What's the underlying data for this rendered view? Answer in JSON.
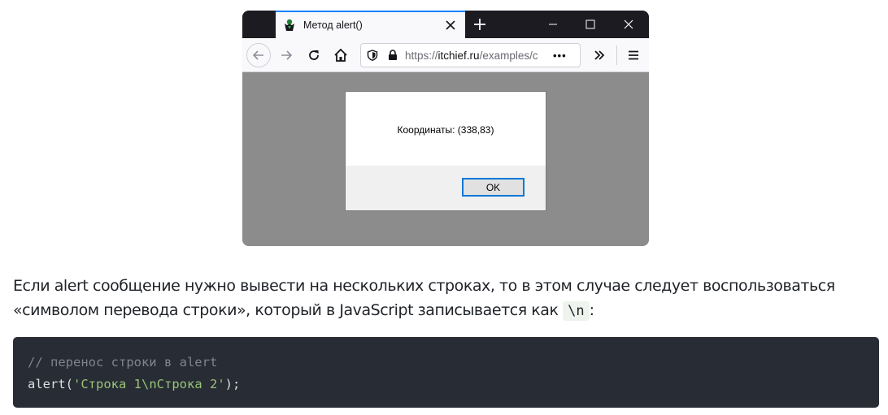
{
  "browser": {
    "tab_title": "Метод alert()",
    "url_prefix": "https://",
    "url_host": "itchief.ru",
    "url_path": "/examples/c",
    "url_more": "•••",
    "dialog": {
      "message": "Координаты: (338,83)",
      "ok_label": "OK"
    }
  },
  "article": {
    "text_before": "Если alert сообщение нужно вывести на нескольких строках, то в этом случае следует воспользоваться «символом перевода строки», который в JavaScript записывается как ",
    "inline_code": "\\n",
    "text_after": ":"
  },
  "code": {
    "comment": "// перенос строки в alert",
    "fn_name": "alert",
    "open": "(",
    "string": "'Строка 1\\nСтрока 2'",
    "close": ");"
  },
  "colors": {
    "code_background": "#282c34",
    "code_string": "#98c379",
    "code_comment": "#7f848e",
    "tab_accent": "#0a84ff",
    "dialog_button_border": "#0078d7"
  }
}
